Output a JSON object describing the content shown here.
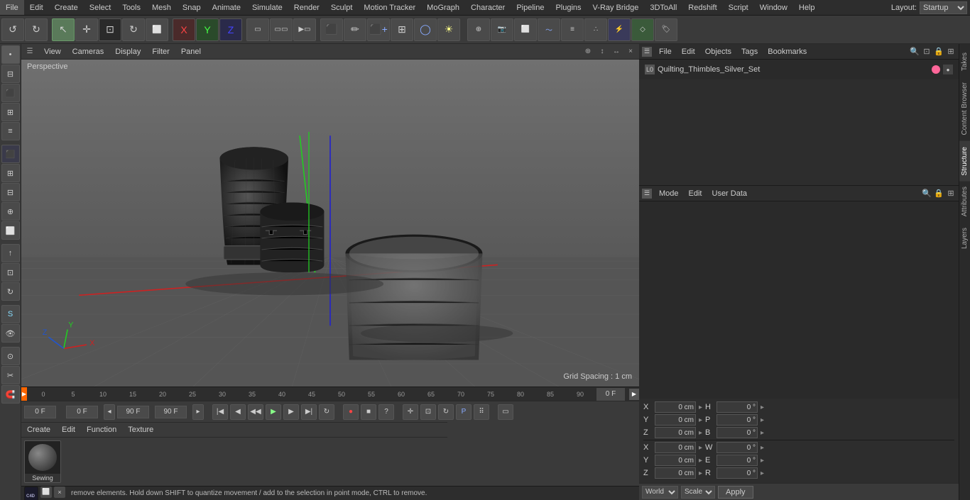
{
  "app": {
    "title": "Cinema 4D",
    "layout_label": "Layout:",
    "layout_value": "Startup"
  },
  "menu": {
    "items": [
      "File",
      "Edit",
      "Create",
      "Select",
      "Tools",
      "Mesh",
      "Snap",
      "Animate",
      "Simulate",
      "Render",
      "Sculpt",
      "Motion Tracker",
      "MoGraph",
      "Character",
      "Pipeline",
      "Plugins",
      "V-Ray Bridge",
      "3DToAll",
      "Redshift",
      "Script",
      "Window",
      "Help"
    ]
  },
  "viewport": {
    "view_label": "View",
    "cameras_label": "Cameras",
    "display_label": "Display",
    "filter_label": "Filter",
    "panel_label": "Panel",
    "perspective_label": "Perspective",
    "grid_spacing_label": "Grid Spacing : 1 cm"
  },
  "timeline": {
    "markers": [
      0,
      5,
      10,
      15,
      20,
      25,
      30,
      35,
      40,
      45,
      50,
      55,
      60,
      65,
      70,
      75,
      80,
      85,
      90
    ],
    "frame_input": "0 F",
    "end_frame": "0 F"
  },
  "transport": {
    "start_frame": "0 F",
    "current_frame_a": "0 F",
    "end_frame_a": "90 F",
    "end_frame_b": "90 F"
  },
  "object_manager": {
    "header_items": [
      "File",
      "Edit",
      "Objects",
      "Tags",
      "Bookmarks"
    ],
    "objects": [
      {
        "name": "Quilting_Thimbles_Silver_Set",
        "icon": "L0",
        "has_dot": true
      }
    ]
  },
  "attributes": {
    "header_items": [
      "Mode",
      "Edit",
      "User Data"
    ],
    "coord_labels": {
      "x": "X",
      "y": "Y",
      "z": "Z",
      "h": "H",
      "p": "P",
      "b": "B"
    },
    "coord_values": {
      "x_pos": "0 cm",
      "y_pos": "0 cm",
      "z_pos": "0 cm",
      "h_rot": "0 °",
      "p_rot": "0 °",
      "b_rot": "0 °",
      "x_size": "0 cm",
      "y_size": "0 cm",
      "z_size": "0 cm",
      "w_size": "0 °",
      "e_size": "0 °",
      "r_size": "0 °"
    },
    "size_labels": {
      "x": "X",
      "y": "Y",
      "z": "Z",
      "w": "W",
      "e": "E",
      "r": "R"
    }
  },
  "bottom_bar": {
    "world_label": "World",
    "scale_label": "Scale",
    "apply_label": "Apply"
  },
  "status": {
    "text": "remove elements. Hold down SHIFT to quantize movement / add to the selection in point mode, CTRL to remove."
  },
  "materials": {
    "create_label": "Create",
    "edit_label": "Edit",
    "function_label": "Function",
    "texture_label": "Texture",
    "items": [
      {
        "label": "Sewing"
      }
    ]
  },
  "vtabs_right": {
    "tabs": [
      "Takes",
      "Content Browser",
      "Structure",
      "Attributes",
      "Layers"
    ]
  },
  "icons": {
    "undo": "↺",
    "redo": "↻",
    "select_arrow": "↖",
    "move": "✛",
    "scale": "⊞",
    "rotate": "↻",
    "axis_x": "X",
    "axis_y": "Y",
    "axis_z": "Z",
    "frame": "▭",
    "play": "▶",
    "stop": "■",
    "prev": "◀",
    "next": "▶",
    "gear": "⚙",
    "lock": "🔒",
    "search": "🔍"
  }
}
